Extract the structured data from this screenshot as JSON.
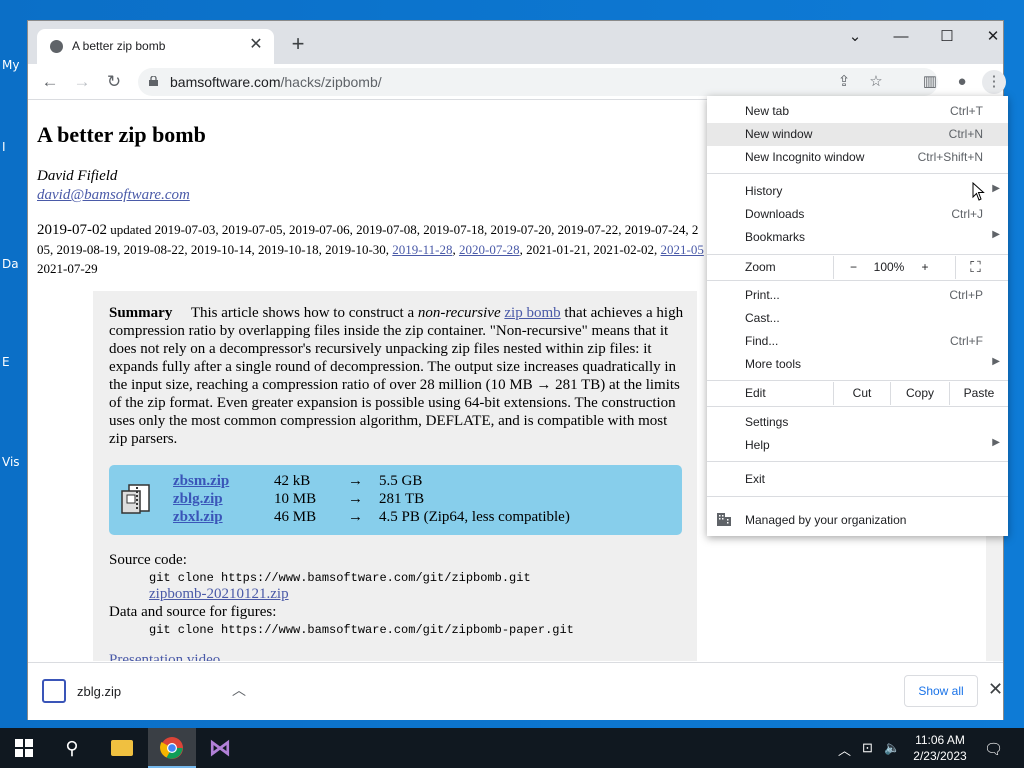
{
  "desktop": {
    "labels": [
      "My",
      "I",
      "Da",
      "E",
      "Vis"
    ]
  },
  "browser": {
    "tab_title": "A better zip bomb",
    "new_tab_symbol": "+",
    "url_domain": "bamsoftware.com",
    "url_path": "/hacks/zipbomb/"
  },
  "page": {
    "title": "A better zip bomb",
    "author": "David Fifield",
    "email": "david@bamsoftware.com",
    "date_main": "2019-07-02",
    "updated_word": "updated",
    "dates_line1": "2019-07-03, 2019-07-05, 2019-07-06, 2019-07-08, 2019-07-18, 2019-07-20, 2019-07-22, 2019-07-24, 2",
    "dates_line2_pre": "05, 2019-08-19, 2019-08-22, 2019-10-14, 2019-10-18, 2019-10-30,",
    "date_link1": "2019-11-28",
    "date_link2": "2020-07-28",
    "dates_line2_mid": "2021-01-21, 2021-02-02,",
    "date_link3": "2021-05",
    "dates_line3": "2021-07-29",
    "summary_heading": "Summary",
    "summary_p1": "This article shows how to construct a",
    "summary_em": "non-recursive",
    "summary_link": "zip bomb",
    "summary_p2": "that achieves a high compression ratio by overlapping files inside the zip container. \"Non-recursive\" means that it does not rely on a decompressor's recursively unpacking zip files nested within zip files: it expands fully after a single round of decompression. The output size increases quadratically in the input size, reaching a compression ratio of over 28 million (10 MB → 281 TB) at the limits of the zip format. Even greater expansion is possible using 64-bit extensions. The construction uses only the most common compression algorithm, DEFLATE, and is compatible with most zip parsers.",
    "files": [
      {
        "name": "zbsm.zip",
        "size": "42 kB",
        "arrow": "→",
        "output": "5.5 GB"
      },
      {
        "name": "zblg.zip",
        "size": "10 MB",
        "arrow": "→",
        "output": "281 TB"
      },
      {
        "name": "zbxl.zip",
        "size": "46 MB",
        "arrow": "→",
        "output": "4.5 PB (Zip64, less compatible)"
      }
    ],
    "source_label": "Source code:",
    "source_cmd": "git clone https://www.bamsoftware.com/git/zipbomb.git",
    "source_zip": "zipbomb-20210121.zip",
    "data_label": "Data and source for figures:",
    "data_cmd": "git clone https://www.bamsoftware.com/git/zipbomb-paper.git",
    "presentation": "Presentation video"
  },
  "menu": {
    "new_tab": "New tab",
    "new_tab_sc": "Ctrl+T",
    "new_window": "New window",
    "new_window_sc": "Ctrl+N",
    "incognito": "New Incognito window",
    "incognito_sc": "Ctrl+Shift+N",
    "history": "History",
    "downloads": "Downloads",
    "downloads_sc": "Ctrl+J",
    "bookmarks": "Bookmarks",
    "zoom": "Zoom",
    "zoom_minus": "−",
    "zoom_value": "100%",
    "zoom_plus": "+",
    "print": "Print...",
    "print_sc": "Ctrl+P",
    "cast": "Cast...",
    "find": "Find...",
    "find_sc": "Ctrl+F",
    "more_tools": "More tools",
    "edit": "Edit",
    "cut": "Cut",
    "copy": "Copy",
    "paste": "Paste",
    "settings": "Settings",
    "help": "Help",
    "exit": "Exit",
    "managed": "Managed by your organization"
  },
  "download_bar": {
    "file": "zblg.zip",
    "show_all": "Show all"
  },
  "taskbar": {
    "time": "11:06 AM",
    "date": "2/23/2023"
  },
  "colors": {
    "link": "#4a5aa8",
    "files_box": "#87ceeb",
    "taskbar": "#101820"
  }
}
